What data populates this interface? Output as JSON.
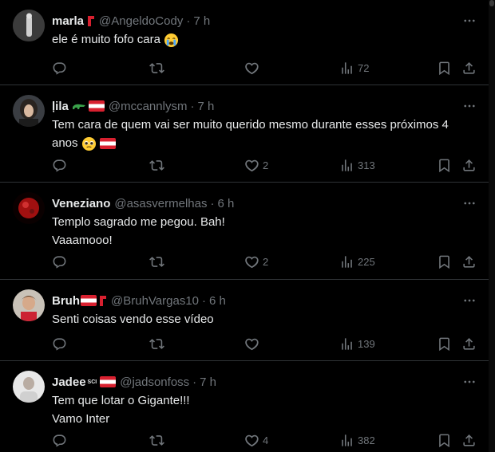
{
  "colors": {
    "background": "#000000",
    "text": "#e7e9ea",
    "muted": "#71767b",
    "divider": "#2f3336"
  },
  "tweets": [
    {
      "name": "marla",
      "handle": "@AngeldoCody",
      "dot": "·",
      "time": "7 h",
      "text_lines": [
        "ele é muito fofo cara"
      ],
      "trailing_emoji": "crying-face",
      "reply_count": "",
      "retweet_count": "",
      "like_count": "",
      "view_count": "72"
    },
    {
      "name": "ļila",
      "handle": "@mccannlysm",
      "dot": "·",
      "time": "7 h",
      "text_lines": [
        "Tem cara de quem vai ser muito querido mesmo durante esses próximos 4",
        "anos"
      ],
      "trailing_emoji": "pleading-face",
      "reply_count": "",
      "retweet_count": "",
      "like_count": "2",
      "view_count": "313"
    },
    {
      "name": "Veneziano",
      "handle": "@asasvermelhas",
      "dot": "·",
      "time": "6 h",
      "text_lines": [
        "Templo sagrado me pegou. Bah!",
        "Vaaamooo!"
      ],
      "reply_count": "",
      "retweet_count": "",
      "like_count": "2",
      "view_count": "225"
    },
    {
      "name": "Bruh",
      "handle": "@BruhVargas10",
      "dot": "·",
      "time": "6 h",
      "text_lines": [
        "Senti coisas vendo esse vídeo"
      ],
      "reply_count": "",
      "retweet_count": "",
      "like_count": "",
      "view_count": "139"
    },
    {
      "name": "Jadee",
      "name_suffix": "SCI",
      "handle": "@jadsonfoss",
      "dot": "·",
      "time": "7 h",
      "text_lines": [
        "Tem que lotar o Gigante!!!",
        "Vamo Inter"
      ],
      "reply_count": "",
      "retweet_count": "",
      "like_count": "4",
      "view_count": "382"
    }
  ]
}
